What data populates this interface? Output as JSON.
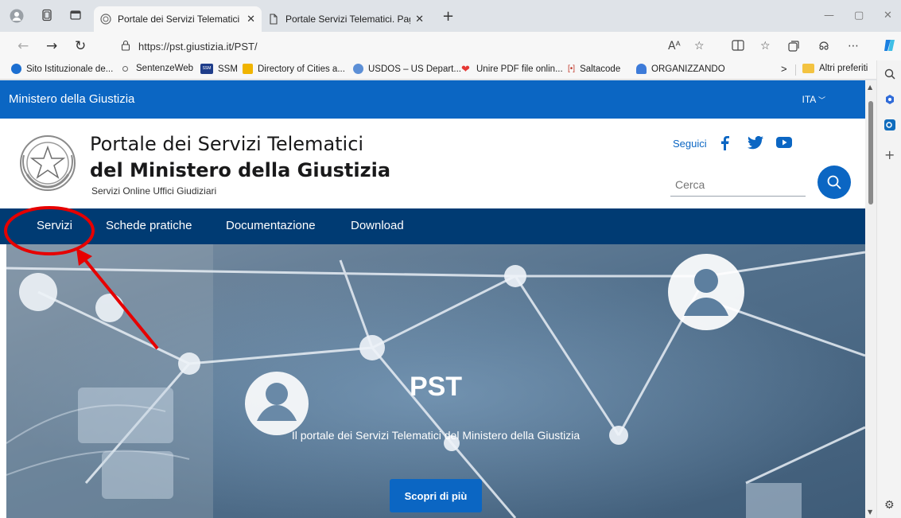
{
  "browser": {
    "tabs": [
      {
        "title": "Portale dei Servizi Telematici del",
        "active": true
      },
      {
        "title": "Portale Servizi Telematici. Pagam",
        "active": false
      }
    ],
    "url": "https://pst.giustizia.it/PST/",
    "read_aloud_label": "Aᴬ",
    "more_label": "⋯",
    "bookmarks": [
      "Sito Istituzionale de...",
      "SentenzeWeb",
      "SSM",
      "Directory of Cities a...",
      "USDOS – US Depart...",
      "Unire PDF file onlin...",
      "Saltacode",
      "ORGANIZZANDO"
    ],
    "bookmarks_overflow": ">",
    "other_favorites": "Altri preferiti",
    "ssm_icon_text": "SSM",
    "saltacode_icon_text": "[•]"
  },
  "site": {
    "ministry": "Ministero della Giustizia",
    "language": "ITA",
    "title_line1": "Portale dei Servizi Telematici",
    "title_line2": "del Ministero della Giustizia",
    "subtitle": "Servizi Online Uffici Giudiziari",
    "follow_label": "Seguici",
    "search_placeholder": "Cerca",
    "nav": [
      "Servizi",
      "Schede pratiche",
      "Documentazione",
      "Download"
    ]
  },
  "hero": {
    "title": "PST",
    "subtitle": "Il portale dei Servizi Telematici del Ministero della Giustizia",
    "button": "Scopri di più"
  },
  "colors": {
    "primary_blue": "#0b66c3",
    "nav_dark": "#003b73",
    "annotation_red": "#e60000"
  }
}
